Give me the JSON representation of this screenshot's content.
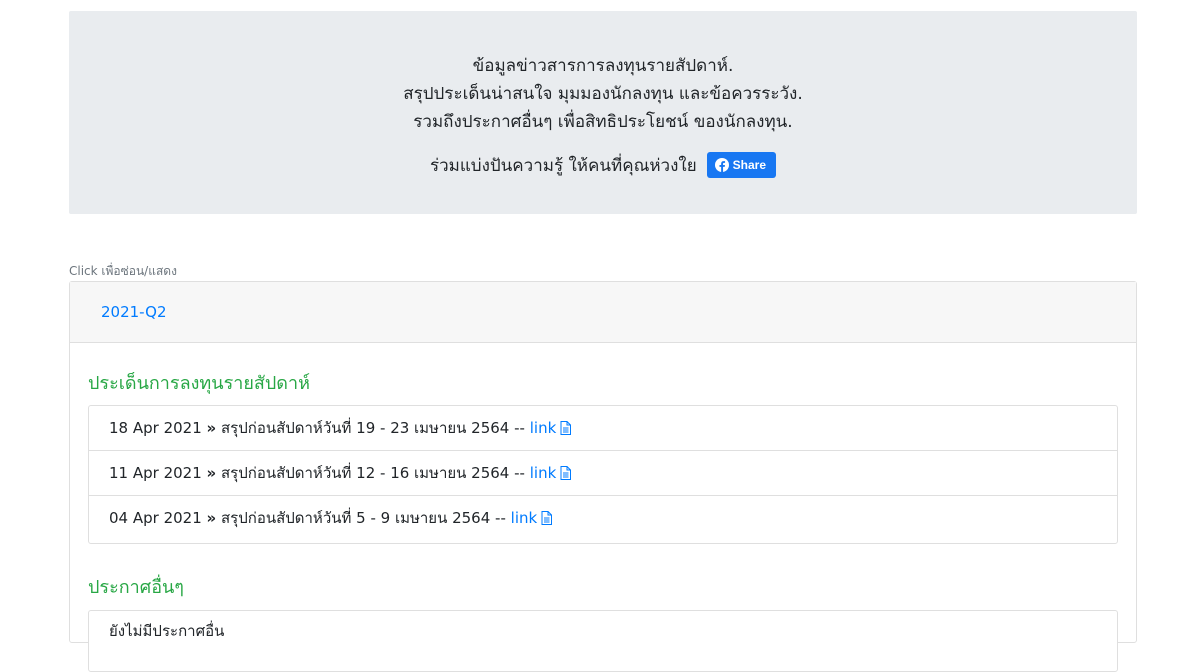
{
  "banner": {
    "line1": "ข้อมูลข่าวสารการลงทุนรายสัปดาห์.",
    "line2": "สรุปประเด็นน่าสนใจ มุมมองนักลงทุน และข้อควรระวัง.",
    "line3": "รวมถึงประกาศอื่นๆ เพื่อสิทธิประโยชน์ ของนักลงทุน.",
    "share_text": "ร่วมแบ่งปันความรู้ ให้คนที่คุณห่วงใย",
    "share_button": "Share",
    "share_icon": "facebook-icon",
    "share_color": "#1877f2"
  },
  "hint": "Click เพื่อซ่อน/แสดง",
  "accordion": {
    "header": "2021-Q2",
    "sections": [
      {
        "title": "ประเด็นการลงทุนรายสัปดาห์",
        "items": [
          {
            "date": "18 Apr 2021",
            "separator": "»",
            "text": "สรุปก่อนสัปดาห์วันที่ 19 - 23 เมษายน 2564 --",
            "link": "link",
            "icon": "document-icon"
          },
          {
            "date": "11 Apr 2021",
            "separator": "»",
            "text": "สรุปก่อนสัปดาห์วันที่ 12 - 16 เมษายน 2564 --",
            "link": "link",
            "icon": "document-icon"
          },
          {
            "date": "04 Apr 2021",
            "separator": "»",
            "text": "สรุปก่อนสัปดาห์วันที่ 5 - 9 เมษายน 2564 --",
            "link": "link",
            "icon": "document-icon"
          }
        ]
      },
      {
        "title": "ประกาศอื่นๆ",
        "items": [
          {
            "text": "ยังไม่มีประกาศอื่น"
          }
        ]
      }
    ]
  },
  "colors": {
    "accent": "#007bff",
    "section_title": "#28a745",
    "banner_bg": "#e9ecef"
  }
}
